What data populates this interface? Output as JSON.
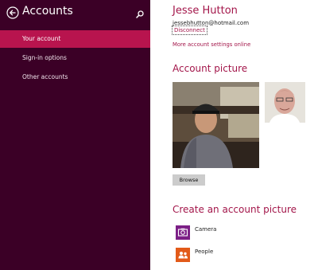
{
  "sidebar": {
    "title": "Accounts",
    "items": [
      {
        "label": "Your account",
        "active": true
      },
      {
        "label": "Sign-in options",
        "active": false
      },
      {
        "label": "Other accounts",
        "active": false
      }
    ]
  },
  "account": {
    "name": "Jesse Hutton",
    "email": "jessebhutton@hotmail.com",
    "disconnect_label": "Disconnect",
    "more_settings_label": "More account settings online"
  },
  "account_picture": {
    "heading": "Account picture",
    "browse_label": "Browse"
  },
  "create_picture": {
    "heading": "Create an account picture",
    "apps": [
      {
        "label": "Camera",
        "icon": "camera-icon",
        "color": "#7c1f86"
      },
      {
        "label": "People",
        "icon": "people-icon",
        "color": "#e25a19"
      }
    ]
  },
  "colors": {
    "sidebar_bg": "#3b0026",
    "accent": "#b8144e",
    "heading": "#a3164a"
  }
}
